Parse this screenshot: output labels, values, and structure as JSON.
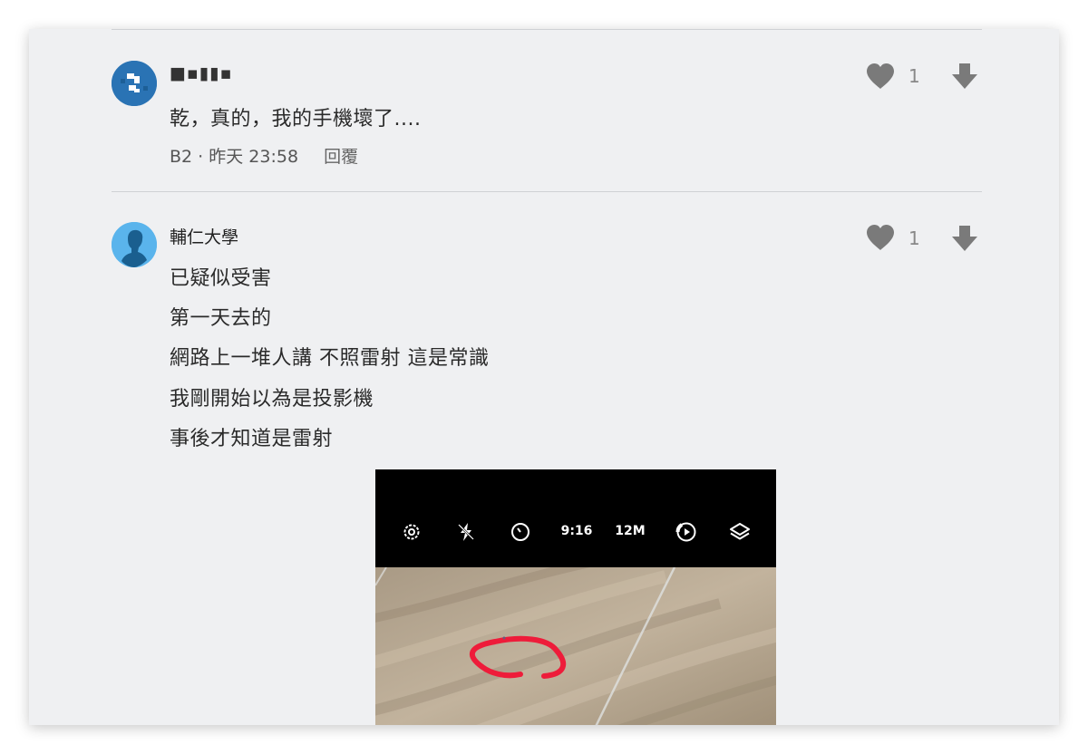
{
  "comments": [
    {
      "username": "■▪︎▮▮▪︎",
      "lines": [
        "乾，真的，我的手機壞了...."
      ],
      "floor": "B2",
      "time": "昨天 23:58",
      "reply_label": "回覆",
      "likes": "1",
      "avatar_color": "#2a73b4"
    },
    {
      "username": "輔仁大學",
      "lines": [
        "已疑似受害",
        "第一天去的",
        "網路上一堆人講 不照雷射 這是常識",
        "我剛開始以為是投影機",
        "事後才知道是雷射"
      ],
      "likes": "1",
      "avatar_color": "#5ab4ec"
    }
  ],
  "photo": {
    "camera_bar": {
      "items": [
        {
          "icon": "settings-icon"
        },
        {
          "icon": "flash-off-icon"
        },
        {
          "icon": "timer-icon"
        },
        {
          "label": "9:16"
        },
        {
          "label": "12M"
        },
        {
          "icon": "motion-photo-icon"
        },
        {
          "icon": "layers-icon"
        }
      ]
    },
    "annotation_color": "#ee1c3a"
  },
  "colors": {
    "card_bg": "#eff0f2",
    "icon_gray": "#7a7a7a"
  }
}
